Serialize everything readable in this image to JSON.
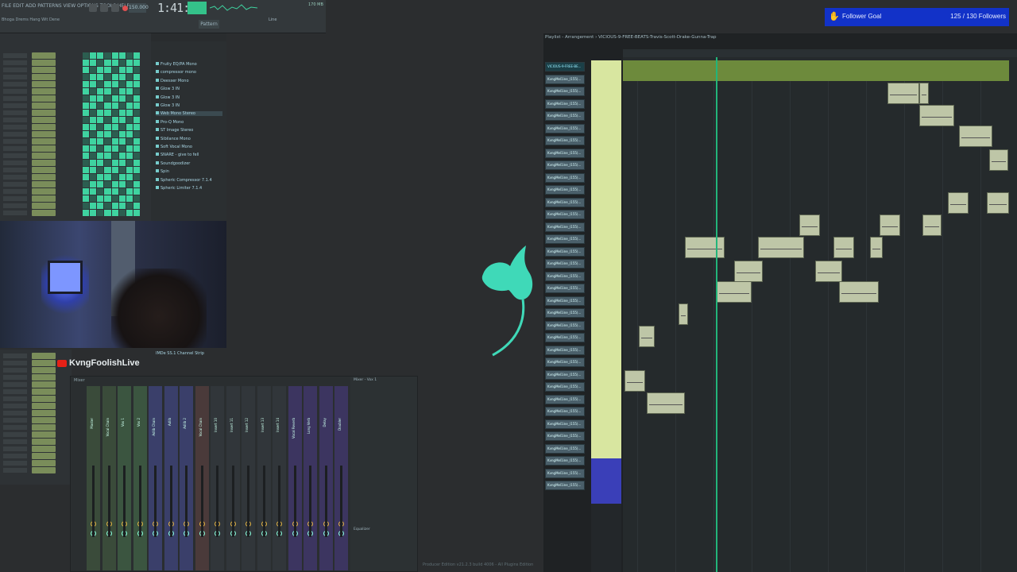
{
  "toolbar": {
    "menu": "FILE EDIT ADD PATTERNS VIEW OPTIONS TOOLS HELP",
    "hint": "Bhoga Drems Hang Wit Dene",
    "bpm": "150.000",
    "clock": "1:41:55",
    "pattern": "Pattern",
    "snap": "Line",
    "cpu": "170 MB"
  },
  "plugins": {
    "items": [
      "Fruity EQ/PA Mono",
      "compressor mono",
      "Deesser Mono",
      "Glow 3 IN",
      "Glow 3 IN",
      "Glow 3 IN",
      "Web Mono Stereo",
      "Pro-Q Mono",
      "ST Image Stereo",
      "Sibilance Mono",
      "Soft Vocal Mono",
      "SNARE - give to fell",
      "Soundgoodizer",
      "Spin",
      "Spheric Compressor 7.1.4",
      "Spheric Limiter 7.1.4"
    ],
    "bottom_item": "IMDe SS.1 Channel Strip"
  },
  "streamer": {
    "name": "KvngFoolishLive"
  },
  "mixer": {
    "title": "Mixer",
    "strips": [
      "Master",
      "Vocal Chain",
      "Vox 1",
      "Vox 2",
      "Adlib Chain",
      "Adlib",
      "Adlib 2",
      "Vocal Chain",
      "Insert 10",
      "Insert 11",
      "Insert 12",
      "Insert 13",
      "Insert 14",
      "Vocal Reverb",
      "Long Verb",
      "Delay",
      "Doubler"
    ],
    "side_label": "Mixer - Vox 1",
    "eq_label": "Equalizer"
  },
  "playlist": {
    "title": "Playlist - Arrangement › VICIOUS-9-FREE-BEATS-Travis-Scott-Drake-Gunna-Trap",
    "first_pattern": "VICIOUS-9-FREE-BE...",
    "pattern_prefix": "KvngMel1ine_(155)..."
  },
  "goal": {
    "label": "Follower Goal",
    "count": "125 / 130 Followers"
  },
  "status": "Producer Edition v21.2.3 build 4006 - All Plugins Edition"
}
